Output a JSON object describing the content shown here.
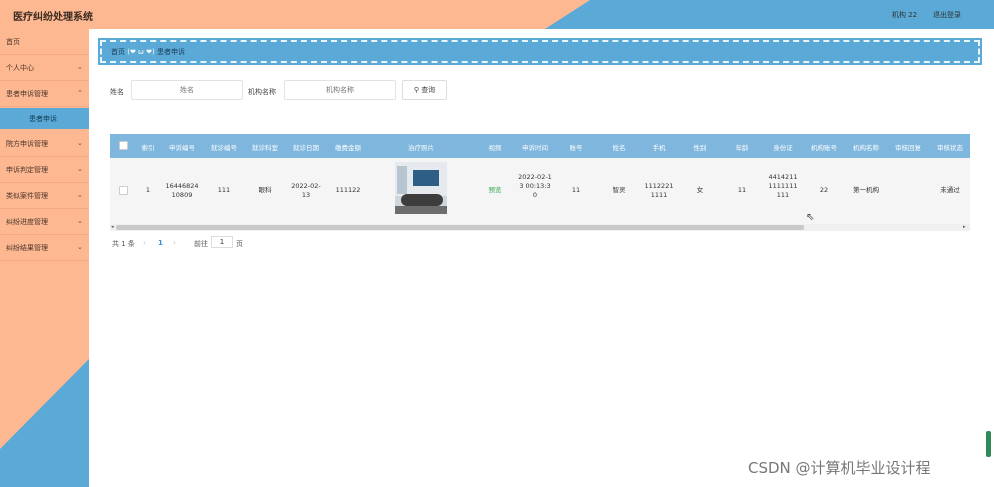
{
  "header": {
    "title": "医疗纠纷处理系统",
    "user": "机构 22",
    "logout": "退出登录"
  },
  "sidebar": {
    "items": [
      {
        "label": "首页"
      },
      {
        "label": "个人中心"
      },
      {
        "label": "患者申诉管理"
      },
      {
        "label": "患者申诉",
        "sub": true
      },
      {
        "label": "院方申诉管理"
      },
      {
        "label": "申诉判定管理"
      },
      {
        "label": "类似案件管理"
      },
      {
        "label": "纠纷进度管理"
      },
      {
        "label": "纠纷结果管理"
      }
    ]
  },
  "breadcrumb": {
    "home": "首页",
    "separator": "(❤ ω ❤)",
    "current": "患者申诉"
  },
  "search": {
    "name_label": "姓名",
    "name_placeholder": "姓名",
    "org_label": "机构名称",
    "org_placeholder": "机构名称",
    "query_button": "查询"
  },
  "table": {
    "headers": [
      "索引",
      "申诉编号",
      "就诊编号",
      "就诊科室",
      "就诊日期",
      "缴费金额",
      "治疗照片",
      "视频",
      "申诉时间",
      "账号",
      "姓名",
      "手机",
      "性别",
      "年龄",
      "身份证",
      "机构账号",
      "机构名称",
      "审核回复",
      "审核状态"
    ],
    "rows": [
      {
        "index": "1",
        "appeal_no": "1644682410809",
        "visit_no": "111",
        "department": "眼科",
        "visit_date": "2022-02-13",
        "amount": "111122",
        "video": "预览",
        "appeal_time": "2022-02-13 00:13:30",
        "account": "11",
        "name": "智灵",
        "phone": "11122211111",
        "gender": "女",
        "age": "11",
        "id_card": "44142111111111111",
        "org_account": "22",
        "org_name": "第一机构",
        "review_reply": "",
        "review_status": "未通过"
      }
    ]
  },
  "pagination": {
    "total": "共 1 条",
    "prev": "‹",
    "current_page": "1",
    "next": "›",
    "goto_label": "前往",
    "goto_value": "1",
    "page_unit": "页"
  },
  "watermark": "CSDN @计算机毕业设计程",
  "colors": {
    "peach": "#fdb892",
    "blue": "#5aa9d6",
    "table_header": "#7fb6dd"
  }
}
